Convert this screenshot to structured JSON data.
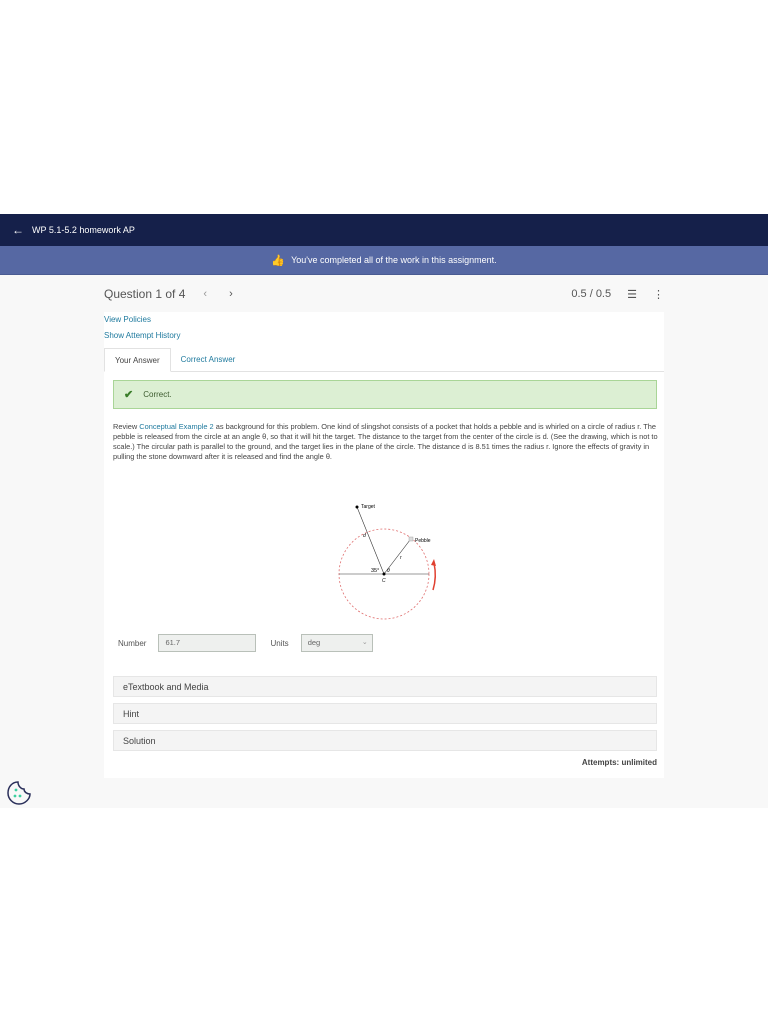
{
  "topbar": {
    "title": "WP 5.1-5.2 homework AP",
    "back_icon": "arrow-left-icon"
  },
  "banner": {
    "text": "You've completed all of the work in this assignment.",
    "icon": "thumbs-up-icon"
  },
  "question_header": {
    "title": "Question 1 of 4",
    "prev": "‹",
    "next": "›",
    "score": "0.5 / 0.5"
  },
  "links": {
    "view_policies": "View Policies",
    "attempt_history": "Show Attempt History"
  },
  "tabs": [
    {
      "label": "Your Answer"
    },
    {
      "label": "Correct Answer"
    }
  ],
  "feedback": {
    "text": "Correct."
  },
  "problem": {
    "pre": "Review ",
    "link": "Conceptual Example 2",
    "body": " as background for this problem. One kind of slingshot consists of a pocket that holds a pebble and is whirled on a circle of radius r. The pebble is released from the circle at an angle θ, so that it will hit the target. The distance to the target from the center of the circle is d. (See the drawing, which is not to scale.) The circular path is parallel to the ground, and the target lies in the plane of the circle. The distance d is 8.51 times the radius r. Ignore the effects of gravity in pulling the stone downward after it is released and find the angle θ."
  },
  "diagram": {
    "target": "Target",
    "pebble": "Pebble",
    "d": "d",
    "r": "r",
    "angle": "35°",
    "theta": "θ",
    "center": "C"
  },
  "answer": {
    "number_label": "Number",
    "number_value": "61.7",
    "units_label": "Units",
    "units_value": "deg"
  },
  "accordions": [
    {
      "label": "eTextbook and Media"
    },
    {
      "label": "Hint"
    },
    {
      "label": "Solution"
    }
  ],
  "attempts": "Attempts: unlimited",
  "colors": {
    "navy": "#15204a",
    "banner": "#5668a3",
    "link": "#1f7a9e",
    "success_bg": "#dcefd3"
  }
}
